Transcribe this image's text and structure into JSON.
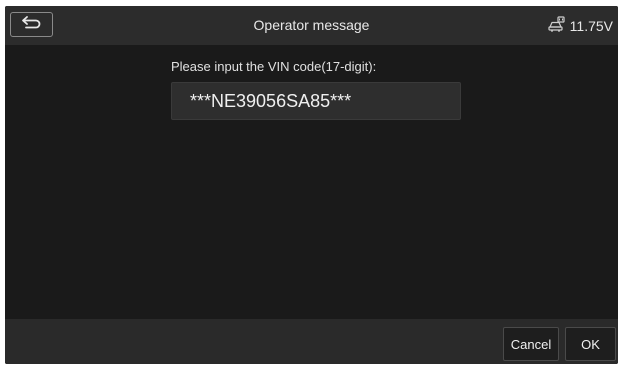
{
  "header": {
    "title": "Operator message",
    "back_icon": "back-arrow-icon",
    "battery_icon": "vehicle-battery-icon",
    "voltage": "11.75V"
  },
  "dialog": {
    "prompt": "Please input the VIN code(17-digit):",
    "vin_value": "***NE39056SA85***"
  },
  "footer": {
    "cancel_label": "Cancel",
    "ok_label": "OK"
  },
  "colors": {
    "background": "#1a1a1a",
    "titlebar": "#2c2c2c",
    "footer": "#2a2a2a",
    "input": "#2e2e2e",
    "text": "#e8e8e8"
  }
}
